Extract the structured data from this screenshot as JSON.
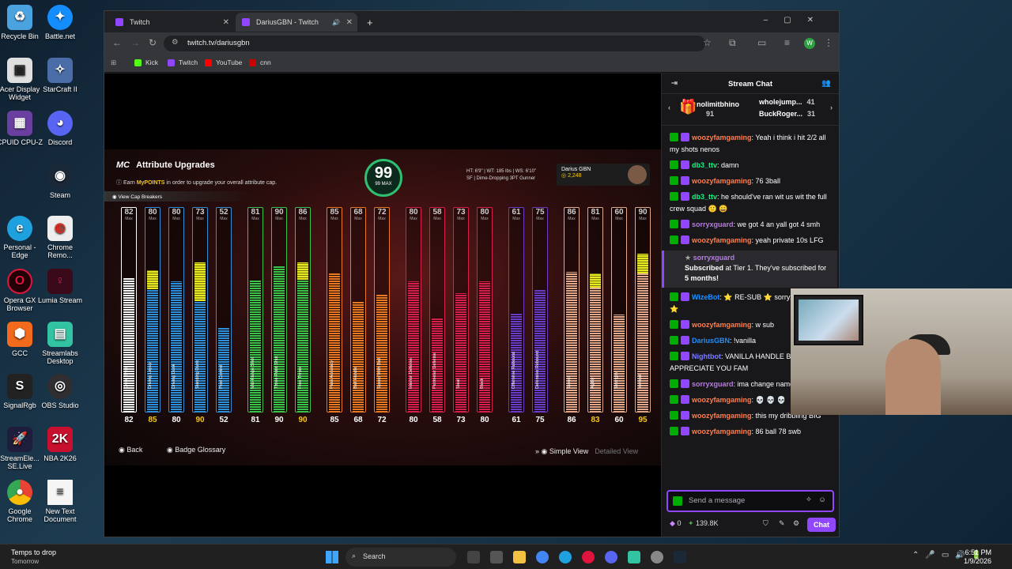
{
  "desktop_icons": [
    {
      "label": "Recycle Bin",
      "icon": "recycle-bin-icon",
      "color": "#4aa3df"
    },
    {
      "label": "Battle.net",
      "icon": "battle-net-icon",
      "color": "#148eff"
    },
    {
      "label": "Acer Display Widget",
      "icon": "display-widget-icon",
      "color": "#e0e0e0"
    },
    {
      "label": "StarCraft II",
      "icon": "starcraft-icon",
      "color": "#4a6da8"
    },
    {
      "label": "CPUID CPU-Z",
      "icon": "cpuz-icon",
      "color": "#6b3fa0"
    },
    {
      "label": "Discord",
      "icon": "discord-icon",
      "color": "#5865f2"
    },
    {
      "label": "Steam",
      "icon": "steam-icon",
      "color": "#1b2838"
    },
    {
      "label": "Personal - Edge",
      "icon": "edge-icon",
      "color": "#1fa1e0"
    },
    {
      "label": "Chrome Remo...",
      "icon": "chrome-remote-icon",
      "color": "#d93025"
    },
    {
      "label": "Opera GX Browser",
      "icon": "opera-gx-icon",
      "color": "#e0143c"
    },
    {
      "label": "Lumia Stream",
      "icon": "lumia-stream-icon",
      "color": "#e0245e"
    },
    {
      "label": "GCC",
      "icon": "gcc-icon",
      "color": "#f26b1d"
    },
    {
      "label": "Streamlabs Desktop",
      "icon": "streamlabs-icon",
      "color": "#31c3a2"
    },
    {
      "label": "SignalRgb",
      "icon": "signalrgb-icon",
      "color": "#222222"
    },
    {
      "label": "OBS Studio",
      "icon": "obs-icon",
      "color": "#302e31"
    },
    {
      "label": "StreamEle... SE.Live",
      "icon": "streamelements-icon",
      "color": "#1e1e3c"
    },
    {
      "label": "NBA 2K26",
      "icon": "nba2k-icon",
      "color": "#c8102e"
    },
    {
      "label": "Google Chrome",
      "icon": "chrome-icon",
      "color": "#4285f4"
    },
    {
      "label": "New Text Document",
      "icon": "text-document-icon",
      "color": "#f5f5f5"
    }
  ],
  "browser": {
    "tabs": [
      {
        "label": "Twitch",
        "active": false
      },
      {
        "label": "DariusGBN - Twitch",
        "active": true
      }
    ],
    "new_tab": "+",
    "url": "twitch.tv/dariusgbn",
    "bookmarks": [
      {
        "label": "Kick",
        "color": "#53fc18"
      },
      {
        "label": "Twitch",
        "color": "#9146ff"
      },
      {
        "label": "YouTube",
        "color": "#ff0000"
      },
      {
        "label": "cnn",
        "color": "#cc0000"
      }
    ],
    "profile_initial": "W"
  },
  "game": {
    "logo": "MC",
    "title": "Attribute Upgrades",
    "subtitle_pre": "Earn ",
    "subtitle_em": "MyPOINTS",
    "subtitle_post": " in order to upgrade your overall attribute cap.",
    "cap_breakers": "View Cap Breakers",
    "overall": "99",
    "overall_label": "99 MAX",
    "stats_line1": "HT: 6'9\"  |  WT: 185 lbs  |  WS: 6'10\"",
    "stats_line2": "SF  |  Dime-Dropping 3PT Gunner",
    "player_name": "Darius GBN",
    "player_vc": "2,248",
    "max_label": "Max",
    "attributes": [
      {
        "name": "Close Shot",
        "cap": "82",
        "current": "82",
        "value": 82,
        "color": "#ffffff"
      },
      {
        "name": "Driving Layup",
        "cap": "80",
        "current": "85",
        "value": 85,
        "color": "#2f8fd8"
      },
      {
        "name": "Driving Dunk",
        "cap": "80",
        "current": "80",
        "value": 80,
        "color": "#2f8fd8"
      },
      {
        "name": "Standing Dunk",
        "cap": "73",
        "current": "90",
        "value": 90,
        "color": "#2f8fd8"
      },
      {
        "name": "Post Control",
        "cap": "52",
        "current": "52",
        "value": 52,
        "color": "#2f8fd8"
      },
      {
        "name": "Mid-Range Shot",
        "cap": "81",
        "current": "81",
        "value": 81,
        "color": "#3cc34a"
      },
      {
        "name": "Three-Point Shot",
        "cap": "90",
        "current": "90",
        "value": 90,
        "color": "#3cc34a"
      },
      {
        "name": "Free Throw",
        "cap": "86",
        "current": "90",
        "value": 90,
        "color": "#3cc34a"
      },
      {
        "name": "Pass Accuracy",
        "cap": "85",
        "current": "85",
        "value": 85,
        "color": "#e97a23"
      },
      {
        "name": "Ball Handle",
        "cap": "68",
        "current": "68",
        "value": 68,
        "color": "#e97a23"
      },
      {
        "name": "Speed With Ball",
        "cap": "72",
        "current": "72",
        "value": 72,
        "color": "#e97a23"
      },
      {
        "name": "Interior Defense",
        "cap": "80",
        "current": "80",
        "value": 80,
        "color": "#d81e4a"
      },
      {
        "name": "Perimeter Defense",
        "cap": "58",
        "current": "58",
        "value": 58,
        "color": "#d81e4a"
      },
      {
        "name": "Steal",
        "cap": "73",
        "current": "73",
        "value": 73,
        "color": "#d81e4a"
      },
      {
        "name": "Block",
        "cap": "80",
        "current": "80",
        "value": 80,
        "color": "#d81e4a"
      },
      {
        "name": "Offensive Rebound",
        "cap": "61",
        "current": "61",
        "value": 61,
        "color": "#6a3cc8"
      },
      {
        "name": "Defensive Rebound",
        "cap": "75",
        "current": "75",
        "value": 75,
        "color": "#6a3cc8"
      },
      {
        "name": "Speed",
        "cap": "86",
        "current": "86",
        "value": 86,
        "color": "#e3a98a"
      },
      {
        "name": "Agility",
        "cap": "81",
        "current": "83",
        "value": 83,
        "color": "#e3a98a"
      },
      {
        "name": "Strength",
        "cap": "60",
        "current": "60",
        "value": 60,
        "color": "#e3a98a"
      },
      {
        "name": "Vertical",
        "cap": "90",
        "current": "95",
        "value": 95,
        "color": "#e3a98a"
      }
    ],
    "footer": {
      "back": "Back",
      "badge_glossary": "Badge Glossary",
      "simple_view": "Simple View",
      "detailed_view": "Detailed View"
    }
  },
  "chat": {
    "title": "Stream Chat",
    "gifters": [
      {
        "name": "nolimitbhino",
        "count": "91"
      },
      {
        "name": "wholejump...",
        "count": "41"
      },
      {
        "name": "BuckRoger...",
        "count": "31"
      }
    ],
    "messages": [
      {
        "user": "woozyfamgaming",
        "color": "#ff7f50",
        "text": ": Yeah i think i hit 2/2 all my shots nenos"
      },
      {
        "user": "db3_ttv",
        "color": "#00ff7f",
        "text": ": damn"
      },
      {
        "user": "woozyfamgaming",
        "color": "#ff7f50",
        "text": ": 76 3ball"
      },
      {
        "user": "db3_ttv",
        "color": "#00ff7f",
        "text": ": he should've ran wit us wit the full crew squad 🙂 😄"
      },
      {
        "user": "sorryxguard",
        "color": "#b57edc",
        "text": ": we got 4 an yall got 4 smh"
      },
      {
        "user": "woozyfamgaming",
        "color": "#ff7f50",
        "text": ": yeah private 10s LFG"
      }
    ],
    "sub_notice": {
      "user": "sorryxguard",
      "line1_b": "Subscribed",
      "line1": " at Tier 1. They've subscribed for ",
      "months": "5 months!"
    },
    "messages2": [
      {
        "user": "WizeBot",
        "color": "#1e90ff",
        "text": ": ⭐ RE-SUB ⭐ sorryxguard (+1) ⭐"
      },
      {
        "user": "woozyfamgaming",
        "color": "#ff7f50",
        "text": ": w sub"
      },
      {
        "user": "DariusGBN",
        "color": "#1e90ff",
        "text": ": !vanilla"
      },
      {
        "user": "Nightbot",
        "color": "#7c7cff",
        "text": ": VANILLA HANDLE BUILDING!! APPRECIATE YOU FAM"
      },
      {
        "user": "sorryxguard",
        "color": "#b57edc",
        "text": ": ima change name back"
      },
      {
        "user": "woozyfamgaming",
        "color": "#ff7f50",
        "text": ": 💀 💀 💀"
      },
      {
        "user": "woozyfamgaming",
        "color": "#ff7f50",
        "text": ": this my dribbling BIG"
      },
      {
        "user": "woozyfamgaming",
        "color": "#ff7f50",
        "text": ": 86 ball 78 swb"
      }
    ],
    "input_placeholder": "Send a message",
    "points": "0",
    "viewer_points": "139.8K",
    "chat_button": "Chat"
  },
  "taskbar": {
    "weather_line1": "Temps to drop",
    "weather_line2": "Tomorrow",
    "search": "Search",
    "time": "6:51 PM",
    "date": "1/9/2026"
  }
}
